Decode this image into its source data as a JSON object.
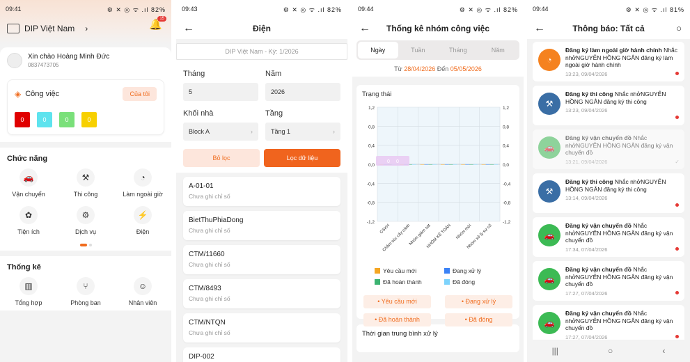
{
  "home": {
    "status": {
      "time": "09:41",
      "icons": "⚙ ✕ ◎ ᯤ .ıl",
      "battery": "82%"
    },
    "brand": "DIP Việt Nam",
    "notif_count": "15",
    "greeting": "Xin chào Hoàng Minh Đức",
    "phone": "0837473705",
    "work_title": "Công việc",
    "mine_label": "Của tôi",
    "counts": [
      {
        "value": "0",
        "color": "#e00000"
      },
      {
        "value": "0",
        "color": "#5ee3ee"
      },
      {
        "value": "0",
        "color": "#7ae07a"
      },
      {
        "value": "0",
        "color": "#f7d000"
      }
    ],
    "functions_title": "Chức năng",
    "functions": [
      {
        "label": "Vận chuyển",
        "icon": "🚗"
      },
      {
        "label": "Thi công",
        "icon": "⚒"
      },
      {
        "label": "Làm ngoài giờ",
        "icon": "◔"
      },
      {
        "label": "Tiện ích",
        "icon": "✿"
      },
      {
        "label": "Dịch vụ",
        "icon": "⚙"
      },
      {
        "label": "Điện",
        "icon": "⚡"
      }
    ],
    "stats_title": "Thống kê",
    "stats": [
      {
        "label": "Tổng hợp",
        "icon": "▥"
      },
      {
        "label": "Phòng ban",
        "icon": "⑂"
      },
      {
        "label": "Nhân viên",
        "icon": "☺"
      }
    ]
  },
  "electric": {
    "status": {
      "time": "09:43",
      "icons": "⚙ ✕ ◎ ᯤ .ıl",
      "battery": "82%"
    },
    "title": "Điện",
    "period": "DIP Việt Nam - Kỳ: 1/2026",
    "month_label": "Tháng",
    "month_value": "5",
    "year_label": "Năm",
    "year_value": "2026",
    "block_label": "Khối nhà",
    "block_value": "Block A",
    "floor_label": "Tầng",
    "floor_value": "Tầng 1",
    "filter_btn": "Bỏ lọc",
    "apply_btn": "Lọc dữ liệu",
    "units": [
      {
        "code": "A-01-01",
        "status": "Chưa ghi chỉ số"
      },
      {
        "code": "BietThuPhiaDong",
        "status": "Chưa ghi chỉ số"
      },
      {
        "code": "CTM/11660",
        "status": "Chưa ghi chỉ số"
      },
      {
        "code": "CTM/8493",
        "status": "Chưa ghi chỉ số"
      },
      {
        "code": "CTM/NTQN",
        "status": "Chưa ghi chỉ số"
      },
      {
        "code": "DIP-002",
        "status": ""
      }
    ]
  },
  "stats": {
    "status": {
      "time": "09:44",
      "icons": "⚙ ✕ ◎ ᯤ .ıl",
      "battery": "82%"
    },
    "title": "Thống kê nhóm công việc",
    "tabs": [
      "Ngày",
      "Tuần",
      "Tháng",
      "Năm"
    ],
    "from_label": "Từ",
    "from_date": "28/04/2026",
    "to_label": "Đến",
    "to_date": "05/05/2026",
    "chart_title": "Trạng thái",
    "chips": [
      "Yêu cầu mới",
      "Đang xử lý",
      "Đã hoàn thành",
      "Đã đóng"
    ],
    "next_card": "Thời gian trung bình xử lý"
  },
  "chart_data": {
    "type": "bar",
    "title": "Trạng thái",
    "categories": [
      "CSKH",
      "Chăm sóc cây cảnh",
      "Nhóm giám sát",
      "NHÓM KẾ TOÁN",
      "Nhóm mới",
      "Nhóm xử lý sự cố"
    ],
    "series": [
      {
        "name": "Yêu cầu mới",
        "color": "#f5a623",
        "values": [
          0,
          0,
          0,
          0,
          0,
          0
        ]
      },
      {
        "name": "Đang xử lý",
        "color": "#3b82f6",
        "values": [
          0,
          0,
          0,
          0,
          0,
          0
        ]
      },
      {
        "name": "Đã hoàn thành",
        "color": "#3cb371",
        "values": [
          0,
          0,
          0,
          0,
          0,
          0
        ]
      },
      {
        "name": "Đã đóng",
        "color": "#7dd3fc",
        "values": [
          0,
          0,
          0,
          0,
          0,
          0
        ]
      }
    ],
    "yticks": [
      "1,2",
      "0,8",
      "0,4",
      "0,0",
      "-0,4",
      "-0,8",
      "-1,2"
    ],
    "ylim": [
      -1.2,
      1.2
    ],
    "tooltip": [
      "0",
      "0"
    ]
  },
  "notifications": {
    "status": {
      "time": "09:44",
      "icons": "⚙ ✕ ◎ ᯤ .ıl",
      "battery": "81%"
    },
    "title": "Thông báo: Tất cả",
    "items": [
      {
        "title": "Đăng ký làm ngoài giờ hành chính",
        "body": "Nhắc nhởNGUYỄN HỒNG NGÂN đăng ký làm ngoài giờ hành chính",
        "date": "13:23, 09/04/2026",
        "color": "#f5821f",
        "icon": "◔",
        "read": false
      },
      {
        "title": "Đăng ký thi công",
        "body": "Nhắc nhởNGUYỄN HỒNG NGÂN đăng ký thi công",
        "date": "13:23, 09/04/2026",
        "color": "#3a6ea5",
        "icon": "⚒",
        "read": false
      },
      {
        "title": "Đăng ký vận chuyển đồ",
        "body": "Nhắc nhởNGUYỄN HỒNG NGÂN đăng ký vận chuyển đồ",
        "date": "13:21, 09/04/2026",
        "color": "#3cba54",
        "icon": "🚗",
        "read": true
      },
      {
        "title": "Đăng ký thi công",
        "body": "Nhắc nhởNGUYỄN HỒNG NGÂN đăng ký thi công",
        "date": "13:14, 09/04/2026",
        "color": "#3a6ea5",
        "icon": "⚒",
        "read": false
      },
      {
        "title": "Đăng ký vận chuyển đồ",
        "body": "Nhắc nhởNGUYỄN HỒNG NGÂN đăng ký vận chuyển đồ",
        "date": "17:34, 07/04/2026",
        "color": "#3cba54",
        "icon": "🚗",
        "read": false
      },
      {
        "title": "Đăng ký vận chuyển đồ",
        "body": "Nhắc nhởNGUYỄN HỒNG NGÂN đăng ký vận chuyển đồ",
        "date": "17:27, 07/04/2026",
        "color": "#3cba54",
        "icon": "🚗",
        "read": false
      },
      {
        "title": "Đăng ký vận chuyển đồ",
        "body": "Nhắc nhởNGUYỄN HỒNG NGÂN đăng ký vận chuyển đồ",
        "date": "17:27, 07/04/2026",
        "color": "#3cba54",
        "icon": "🚗",
        "read": false
      }
    ]
  }
}
